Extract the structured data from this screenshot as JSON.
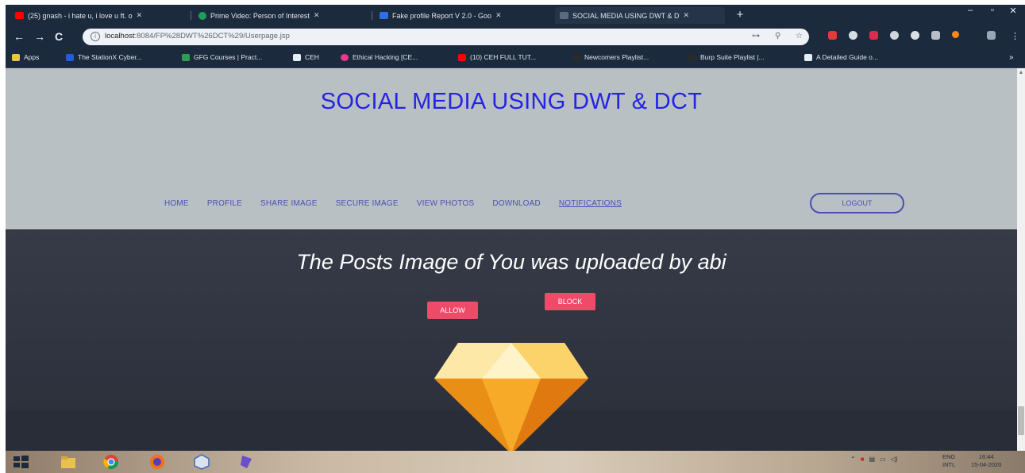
{
  "browser": {
    "tabs": [
      {
        "label": "(25) gnash - i hate u, i love u ft. o",
        "color": "#ff0000",
        "active": false
      },
      {
        "label": "Prime Video: Person of Interest",
        "color": "#1fa05a",
        "active": false
      },
      {
        "label": "Fake profile Report V 2.0 - Goo",
        "color": "#2f6ee6",
        "active": false
      },
      {
        "label": "SOCIAL MEDIA USING DWT & D",
        "color": "#5a6b80",
        "active": true
      }
    ],
    "new_tab": "+",
    "url_host": "localhost",
    "url_rest": ":8084/FP%28DWT%26DCT%29/Userpage.jsp",
    "window_controls": [
      "–",
      "▫",
      "✕"
    ]
  },
  "bookmarks": [
    {
      "label": "Apps",
      "color": "#e9c24a"
    },
    {
      "label": "The StationX Cyber...",
      "color": "#1f5fd1"
    },
    {
      "label": "GFG Courses | Pract...",
      "color": "#2f9e4f"
    },
    {
      "label": "CEH",
      "color": "#e6edf5"
    },
    {
      "label": "Ethical Hacking [CE...",
      "color": "#e6398d"
    },
    {
      "label": "(10) CEH FULL TUT...",
      "color": "#ff0000"
    },
    {
      "label": "Newcomers Playlist...",
      "color": "#2a2a2a"
    },
    {
      "label": "Burp Suite Playlist |...",
      "color": "#2a2a2a"
    },
    {
      "label": "A Detailed Guide o...",
      "color": "#e6edf5"
    }
  ],
  "site": {
    "title": "SOCIAL MEDIA USING DWT & DCT",
    "nav": [
      "HOME",
      "PROFILE",
      "SHARE IMAGE",
      "SECURE IMAGE",
      "VIEW PHOTOS",
      "DOWNLOAD",
      "NOTIFICATIONS"
    ],
    "logout": "LOGOUT",
    "message": "The Posts Image of You was uploaded by abi",
    "allow": "ALLOW",
    "block": "BLOCK"
  },
  "taskbar": {
    "lang_top": "ENG",
    "lang_bottom": "INTL",
    "time": "16:44",
    "date": "15-04-2020"
  },
  "colors": {
    "title": "#2323e6",
    "nav": "#4a4fb5",
    "button": "#ef4a67",
    "header_band": "#b9c0c4",
    "dark_band": "#333844"
  }
}
